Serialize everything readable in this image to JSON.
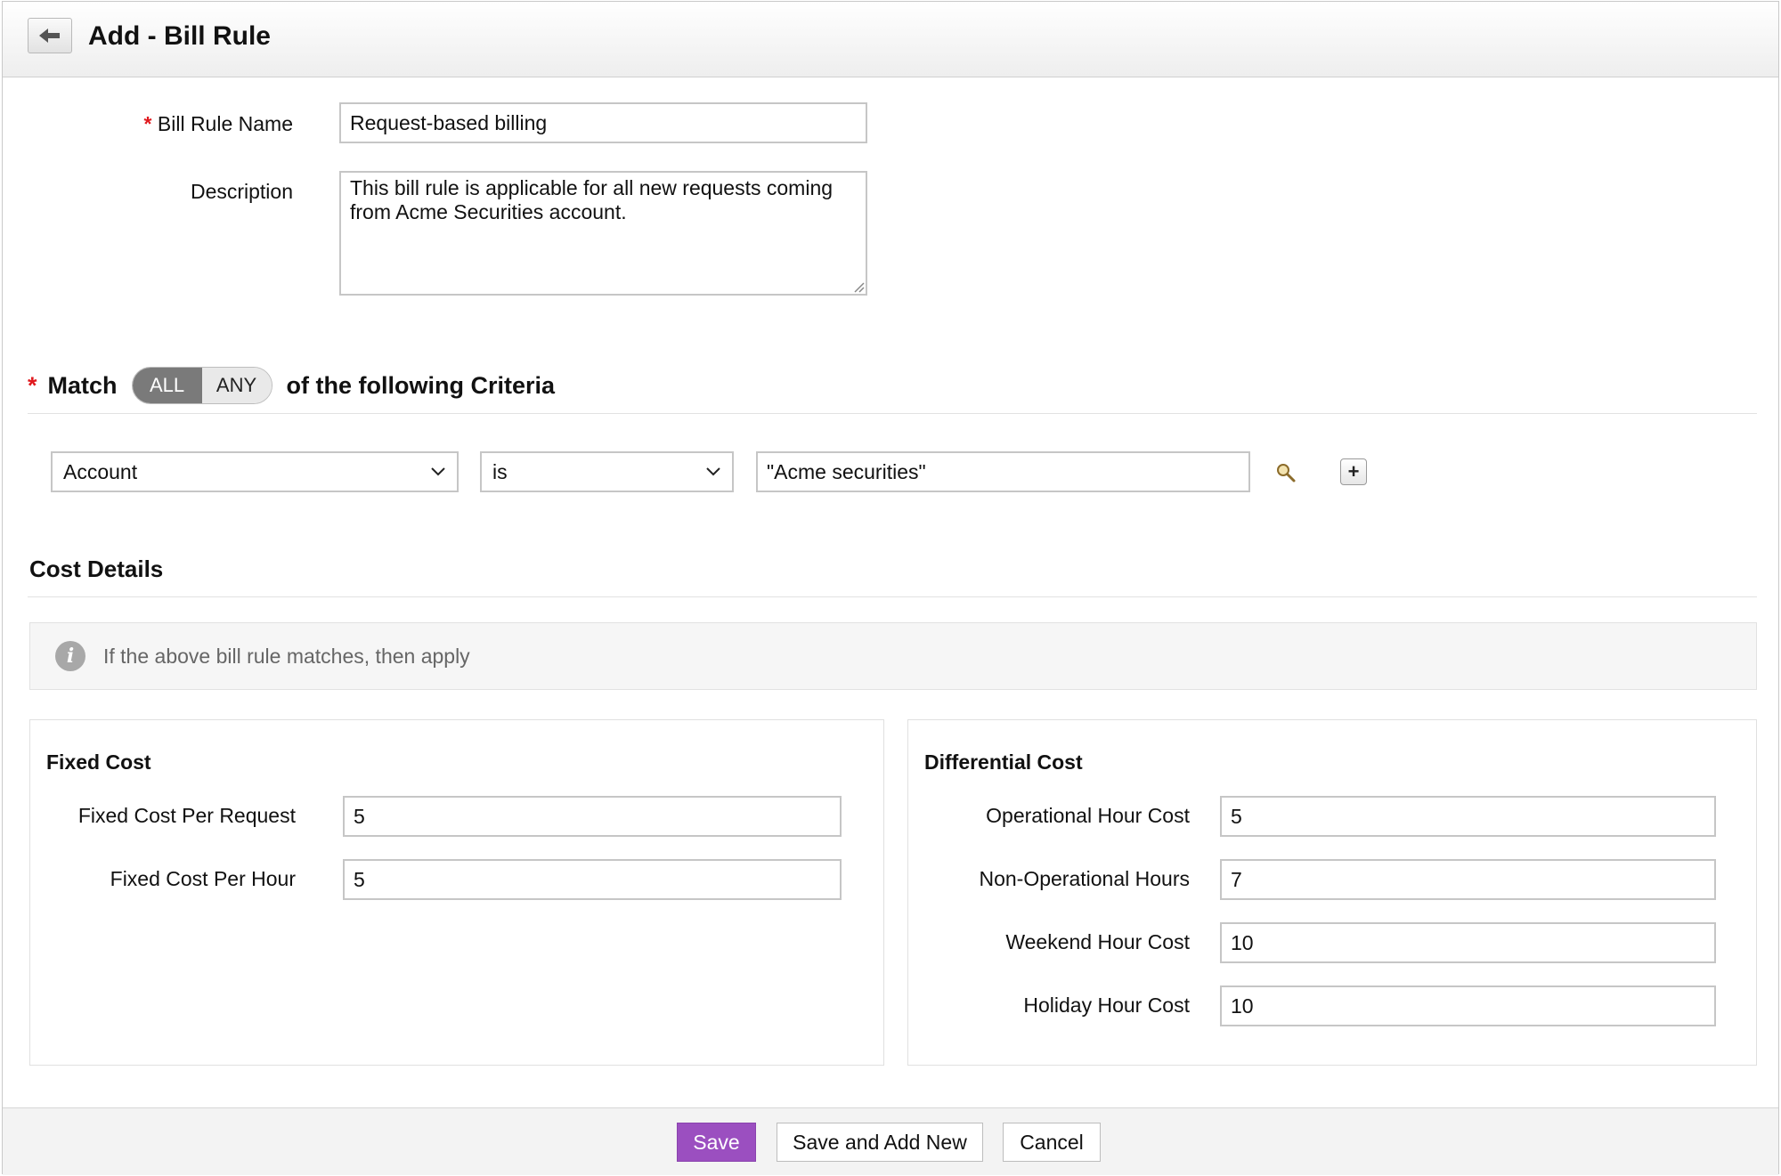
{
  "header": {
    "title": "Add - Bill Rule"
  },
  "form": {
    "name_label": "Bill Rule Name",
    "name_value": "Request-based billing",
    "desc_label": "Description",
    "desc_value": "This bill rule is applicable for all new requests coming from Acme Securities account.",
    "required_mark": "*"
  },
  "match": {
    "label": "Match",
    "options": [
      "ALL",
      "ANY"
    ],
    "selected": "ALL",
    "suffix": "of the following Criteria"
  },
  "criteria": {
    "field": "Account",
    "operator": "is",
    "value": "\"Acme securities\"",
    "add_symbol": "+"
  },
  "cost": {
    "title": "Cost Details",
    "info": "If the above bill rule matches, then apply",
    "info_icon": "info-icon",
    "fixed": {
      "title": "Fixed Cost",
      "rows": [
        {
          "label": "Fixed Cost Per Request",
          "value": "5"
        },
        {
          "label": "Fixed Cost Per Hour",
          "value": "5"
        }
      ]
    },
    "differential": {
      "title": "Differential Cost",
      "rows": [
        {
          "label": "Operational Hour Cost",
          "value": "5"
        },
        {
          "label": "Non-Operational Hours",
          "value": "7"
        },
        {
          "label": "Weekend Hour Cost",
          "value": "10"
        },
        {
          "label": "Holiday Hour Cost",
          "value": "10"
        }
      ]
    }
  },
  "footer": {
    "save": "Save",
    "save_add_new": "Save and Add New",
    "cancel": "Cancel"
  },
  "colors": {
    "primary": "#9b4fc0",
    "required": "#e0191e",
    "toggle_on": "#7a7a7a"
  }
}
